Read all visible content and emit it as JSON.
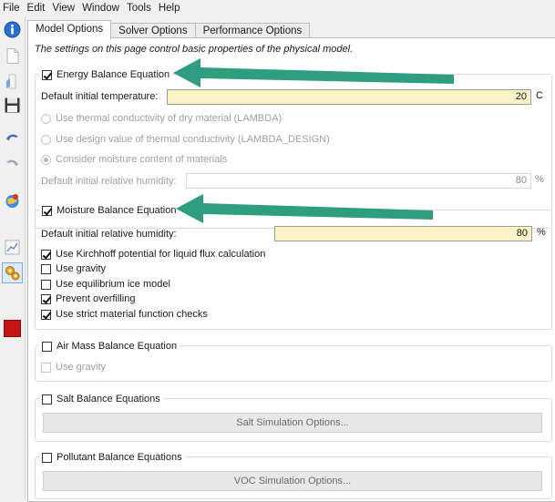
{
  "menu": [
    "File",
    "Edit",
    "View",
    "Window",
    "Tools",
    "Help"
  ],
  "sidebar_icons": [
    "info-icon",
    "new-file-icon",
    "open-file-icon",
    "save-icon",
    "undo-icon",
    "redo-icon",
    "map-pin-icon",
    "chart-icon",
    "gears-icon",
    "red-square-icon"
  ],
  "tabs": [
    "Model Options",
    "Solver Options",
    "Performance Options"
  ],
  "intro": "The settings on this page control basic properties of the physical model.",
  "energy": {
    "title": "Energy Balance Equation",
    "checked": true,
    "temp_label": "Default initial temperature:",
    "temp_value": "20",
    "temp_unit": "C",
    "options": [
      "Use thermal conductivity of dry material (LAMBDA)",
      "Use design value of thermal conductivity (LAMBDA_DESIGN)",
      "Consider moisture content of materials"
    ],
    "rh_label": "Default initial relative humidity:",
    "rh_value": "80",
    "rh_unit": "%"
  },
  "moisture": {
    "title": "Moisture Balance Equation",
    "checked": true,
    "rh_label": "Default initial relative humidity:",
    "rh_value": "80",
    "rh_unit": "%",
    "options": [
      {
        "label": "Use Kirchhoff potential for liquid flux calculation",
        "checked": true
      },
      {
        "label": "Use gravity",
        "checked": false
      },
      {
        "label": "Use equilibrium ice model",
        "checked": false
      },
      {
        "label": "Prevent overfilling",
        "checked": true
      },
      {
        "label": "Use strict material function checks",
        "checked": true
      }
    ]
  },
  "air": {
    "title": "Air Mass Balance Equation",
    "checked": false,
    "option": "Use gravity"
  },
  "salt": {
    "title": "Salt Balance Equations",
    "checked": false,
    "button": "Salt Simulation Options..."
  },
  "pollutant": {
    "title": "Pollutant Balance Equations",
    "checked": false,
    "button": "VOC Simulation Options..."
  },
  "colors": {
    "arrow": "#2e9e7e",
    "highlight_field": "#fbf3c5"
  }
}
